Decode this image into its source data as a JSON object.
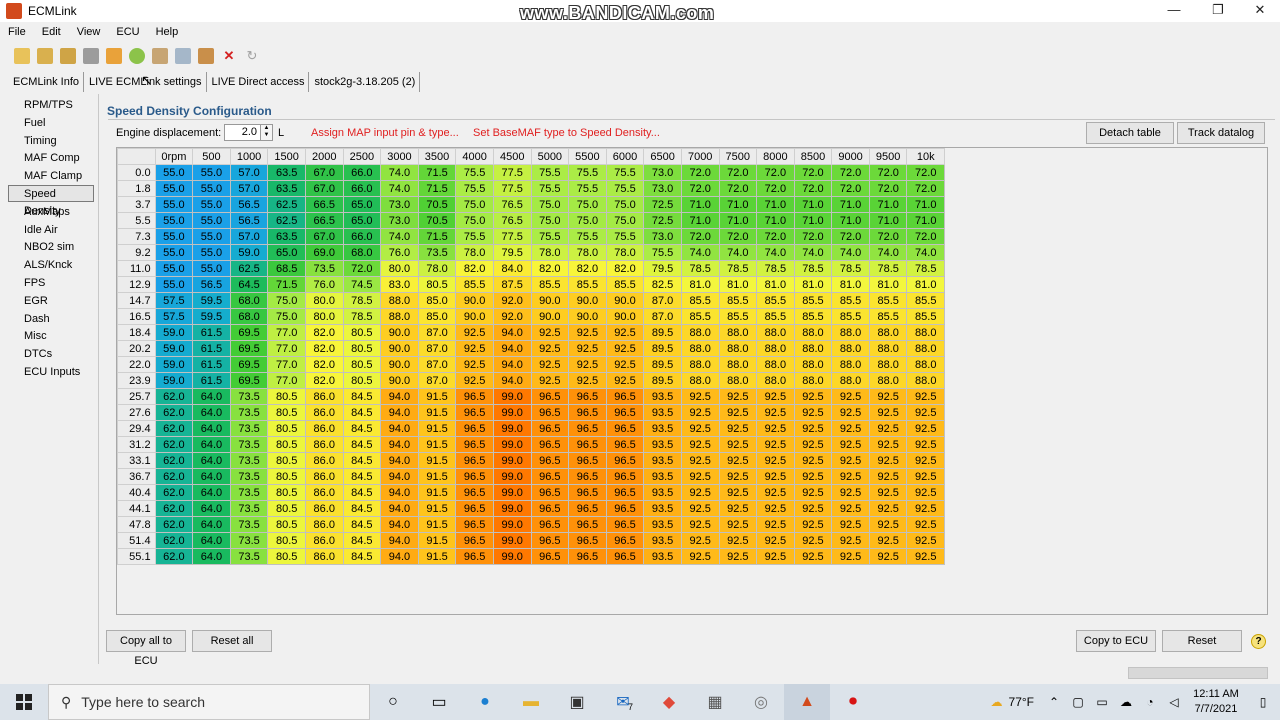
{
  "window": {
    "title": "ECMLink",
    "watermark": "www.BANDICAM.com",
    "minimize": "—",
    "maximize": "❐",
    "close": "✕"
  },
  "menu": [
    "File",
    "Edit",
    "View",
    "ECU",
    "Help"
  ],
  "tabs": [
    "ECMLink Info",
    "LIVE ECMLink settings",
    "LIVE Direct access",
    "stock2g-3.18.205 (2)"
  ],
  "sidebar": [
    "RPM/TPS",
    "Fuel",
    "Timing",
    "MAF Comp",
    "MAF Clamp",
    "Speed Density",
    "AuxMaps",
    "Idle Air",
    "NBO2 sim",
    "ALS/Knck",
    "FPS",
    "EGR",
    "Dash",
    "Misc",
    "DTCs",
    "ECU Inputs"
  ],
  "sidebar_active": 5,
  "panel": {
    "title": "Speed Density Configuration",
    "displacement_label": "Engine displacement:",
    "displacement_value": "2.0",
    "displacement_unit": "L",
    "assign_map_link": "Assign MAP input pin & type...",
    "set_basemaf_link": "Set BaseMAF type to Speed Density...",
    "detach_table": "Detach table",
    "track_datalog": "Track datalog",
    "copy_all": "Copy all to ECU",
    "reset_all": "Reset all",
    "copy_to_ecu": "Copy to ECU",
    "reset": "Reset",
    "help": "?"
  },
  "table": {
    "columns": [
      "0rpm",
      "500",
      "1000",
      "1500",
      "2000",
      "2500",
      "3000",
      "3500",
      "4000",
      "4500",
      "5000",
      "5500",
      "6000",
      "6500",
      "7000",
      "7500",
      "8000",
      "8500",
      "9000",
      "9500",
      "10k"
    ],
    "rows": [
      {
        "label": "0.0",
        "values": [
          "55.0",
          "55.0",
          "57.0",
          "63.5",
          "67.0",
          "66.0",
          "74.0",
          "71.5",
          "75.5",
          "77.5",
          "75.5",
          "75.5",
          "75.5",
          "73.0",
          "72.0",
          "72.0",
          "72.0",
          "72.0",
          "72.0",
          "72.0",
          "72.0"
        ]
      },
      {
        "label": "1.8",
        "values": [
          "55.0",
          "55.0",
          "57.0",
          "63.5",
          "67.0",
          "66.0",
          "74.0",
          "71.5",
          "75.5",
          "77.5",
          "75.5",
          "75.5",
          "75.5",
          "73.0",
          "72.0",
          "72.0",
          "72.0",
          "72.0",
          "72.0",
          "72.0",
          "72.0"
        ]
      },
      {
        "label": "3.7",
        "values": [
          "55.0",
          "55.0",
          "56.5",
          "62.5",
          "66.5",
          "65.0",
          "73.0",
          "70.5",
          "75.0",
          "76.5",
          "75.0",
          "75.0",
          "75.0",
          "72.5",
          "71.0",
          "71.0",
          "71.0",
          "71.0",
          "71.0",
          "71.0",
          "71.0"
        ]
      },
      {
        "label": "5.5",
        "values": [
          "55.0",
          "55.0",
          "56.5",
          "62.5",
          "66.5",
          "65.0",
          "73.0",
          "70.5",
          "75.0",
          "76.5",
          "75.0",
          "75.0",
          "75.0",
          "72.5",
          "71.0",
          "71.0",
          "71.0",
          "71.0",
          "71.0",
          "71.0",
          "71.0"
        ]
      },
      {
        "label": "7.3",
        "values": [
          "55.0",
          "55.0",
          "57.0",
          "63.5",
          "67.0",
          "66.0",
          "74.0",
          "71.5",
          "75.5",
          "77.5",
          "75.5",
          "75.5",
          "75.5",
          "73.0",
          "72.0",
          "72.0",
          "72.0",
          "72.0",
          "72.0",
          "72.0",
          "72.0"
        ]
      },
      {
        "label": "9.2",
        "values": [
          "55.0",
          "55.0",
          "59.0",
          "65.0",
          "69.0",
          "68.0",
          "76.0",
          "73.5",
          "78.0",
          "79.5",
          "78.0",
          "78.0",
          "78.0",
          "75.5",
          "74.0",
          "74.0",
          "74.0",
          "74.0",
          "74.0",
          "74.0",
          "74.0"
        ]
      },
      {
        "label": "11.0",
        "values": [
          "55.0",
          "55.0",
          "62.5",
          "68.5",
          "73.5",
          "72.0",
          "80.0",
          "78.0",
          "82.0",
          "84.0",
          "82.0",
          "82.0",
          "82.0",
          "79.5",
          "78.5",
          "78.5",
          "78.5",
          "78.5",
          "78.5",
          "78.5",
          "78.5"
        ]
      },
      {
        "label": "12.9",
        "values": [
          "55.0",
          "56.5",
          "64.5",
          "71.5",
          "76.0",
          "74.5",
          "83.0",
          "80.5",
          "85.5",
          "87.5",
          "85.5",
          "85.5",
          "85.5",
          "82.5",
          "81.0",
          "81.0",
          "81.0",
          "81.0",
          "81.0",
          "81.0",
          "81.0"
        ]
      },
      {
        "label": "14.7",
        "values": [
          "57.5",
          "59.5",
          "68.0",
          "75.0",
          "80.0",
          "78.5",
          "88.0",
          "85.0",
          "90.0",
          "92.0",
          "90.0",
          "90.0",
          "90.0",
          "87.0",
          "85.5",
          "85.5",
          "85.5",
          "85.5",
          "85.5",
          "85.5",
          "85.5"
        ]
      },
      {
        "label": "16.5",
        "values": [
          "57.5",
          "59.5",
          "68.0",
          "75.0",
          "80.0",
          "78.5",
          "88.0",
          "85.0",
          "90.0",
          "92.0",
          "90.0",
          "90.0",
          "90.0",
          "87.0",
          "85.5",
          "85.5",
          "85.5",
          "85.5",
          "85.5",
          "85.5",
          "85.5"
        ]
      },
      {
        "label": "18.4",
        "values": [
          "59.0",
          "61.5",
          "69.5",
          "77.0",
          "82.0",
          "80.5",
          "90.0",
          "87.0",
          "92.5",
          "94.0",
          "92.5",
          "92.5",
          "92.5",
          "89.5",
          "88.0",
          "88.0",
          "88.0",
          "88.0",
          "88.0",
          "88.0",
          "88.0"
        ]
      },
      {
        "label": "20.2",
        "values": [
          "59.0",
          "61.5",
          "69.5",
          "77.0",
          "82.0",
          "80.5",
          "90.0",
          "87.0",
          "92.5",
          "94.0",
          "92.5",
          "92.5",
          "92.5",
          "89.5",
          "88.0",
          "88.0",
          "88.0",
          "88.0",
          "88.0",
          "88.0",
          "88.0"
        ]
      },
      {
        "label": "22.0",
        "values": [
          "59.0",
          "61.5",
          "69.5",
          "77.0",
          "82.0",
          "80.5",
          "90.0",
          "87.0",
          "92.5",
          "94.0",
          "92.5",
          "92.5",
          "92.5",
          "89.5",
          "88.0",
          "88.0",
          "88.0",
          "88.0",
          "88.0",
          "88.0",
          "88.0"
        ]
      },
      {
        "label": "23.9",
        "values": [
          "59.0",
          "61.5",
          "69.5",
          "77.0",
          "82.0",
          "80.5",
          "90.0",
          "87.0",
          "92.5",
          "94.0",
          "92.5",
          "92.5",
          "92.5",
          "89.5",
          "88.0",
          "88.0",
          "88.0",
          "88.0",
          "88.0",
          "88.0",
          "88.0"
        ]
      },
      {
        "label": "25.7",
        "values": [
          "62.0",
          "64.0",
          "73.5",
          "80.5",
          "86.0",
          "84.5",
          "94.0",
          "91.5",
          "96.5",
          "99.0",
          "96.5",
          "96.5",
          "96.5",
          "93.5",
          "92.5",
          "92.5",
          "92.5",
          "92.5",
          "92.5",
          "92.5",
          "92.5"
        ]
      },
      {
        "label": "27.6",
        "values": [
          "62.0",
          "64.0",
          "73.5",
          "80.5",
          "86.0",
          "84.5",
          "94.0",
          "91.5",
          "96.5",
          "99.0",
          "96.5",
          "96.5",
          "96.5",
          "93.5",
          "92.5",
          "92.5",
          "92.5",
          "92.5",
          "92.5",
          "92.5",
          "92.5"
        ]
      },
      {
        "label": "29.4",
        "values": [
          "62.0",
          "64.0",
          "73.5",
          "80.5",
          "86.0",
          "84.5",
          "94.0",
          "91.5",
          "96.5",
          "99.0",
          "96.5",
          "96.5",
          "96.5",
          "93.5",
          "92.5",
          "92.5",
          "92.5",
          "92.5",
          "92.5",
          "92.5",
          "92.5"
        ]
      },
      {
        "label": "31.2",
        "values": [
          "62.0",
          "64.0",
          "73.5",
          "80.5",
          "86.0",
          "84.5",
          "94.0",
          "91.5",
          "96.5",
          "99.0",
          "96.5",
          "96.5",
          "96.5",
          "93.5",
          "92.5",
          "92.5",
          "92.5",
          "92.5",
          "92.5",
          "92.5",
          "92.5"
        ]
      },
      {
        "label": "33.1",
        "values": [
          "62.0",
          "64.0",
          "73.5",
          "80.5",
          "86.0",
          "84.5",
          "94.0",
          "91.5",
          "96.5",
          "99.0",
          "96.5",
          "96.5",
          "96.5",
          "93.5",
          "92.5",
          "92.5",
          "92.5",
          "92.5",
          "92.5",
          "92.5",
          "92.5"
        ]
      },
      {
        "label": "36.7",
        "values": [
          "62.0",
          "64.0",
          "73.5",
          "80.5",
          "86.0",
          "84.5",
          "94.0",
          "91.5",
          "96.5",
          "99.0",
          "96.5",
          "96.5",
          "96.5",
          "93.5",
          "92.5",
          "92.5",
          "92.5",
          "92.5",
          "92.5",
          "92.5",
          "92.5"
        ]
      },
      {
        "label": "40.4",
        "values": [
          "62.0",
          "64.0",
          "73.5",
          "80.5",
          "86.0",
          "84.5",
          "94.0",
          "91.5",
          "96.5",
          "99.0",
          "96.5",
          "96.5",
          "96.5",
          "93.5",
          "92.5",
          "92.5",
          "92.5",
          "92.5",
          "92.5",
          "92.5",
          "92.5"
        ]
      },
      {
        "label": "44.1",
        "values": [
          "62.0",
          "64.0",
          "73.5",
          "80.5",
          "86.0",
          "84.5",
          "94.0",
          "91.5",
          "96.5",
          "99.0",
          "96.5",
          "96.5",
          "96.5",
          "93.5",
          "92.5",
          "92.5",
          "92.5",
          "92.5",
          "92.5",
          "92.5",
          "92.5"
        ]
      },
      {
        "label": "47.8",
        "values": [
          "62.0",
          "64.0",
          "73.5",
          "80.5",
          "86.0",
          "84.5",
          "94.0",
          "91.5",
          "96.5",
          "99.0",
          "96.5",
          "96.5",
          "96.5",
          "93.5",
          "92.5",
          "92.5",
          "92.5",
          "92.5",
          "92.5",
          "92.5",
          "92.5"
        ]
      },
      {
        "label": "51.4",
        "values": [
          "62.0",
          "64.0",
          "73.5",
          "80.5",
          "86.0",
          "84.5",
          "94.0",
          "91.5",
          "96.5",
          "99.0",
          "96.5",
          "96.5",
          "96.5",
          "93.5",
          "92.5",
          "92.5",
          "92.5",
          "92.5",
          "92.5",
          "92.5",
          "92.5"
        ]
      },
      {
        "label": "55.1",
        "values": [
          "62.0",
          "64.0",
          "73.5",
          "80.5",
          "86.0",
          "84.5",
          "94.0",
          "91.5",
          "96.5",
          "99.0",
          "96.5",
          "96.5",
          "96.5",
          "93.5",
          "92.5",
          "92.5",
          "92.5",
          "92.5",
          "92.5",
          "92.5",
          "92.5"
        ]
      }
    ]
  },
  "colors": {
    "accent_title": "#2a5a8a",
    "link_red": "#e02020",
    "low": "#1aa0e8",
    "high": "#ff7a00"
  },
  "taskbar": {
    "search_placeholder": "Type here to search",
    "mail_badge": "7",
    "temperature": "77°F",
    "time": "12:11 AM",
    "date": "7/7/2021"
  }
}
